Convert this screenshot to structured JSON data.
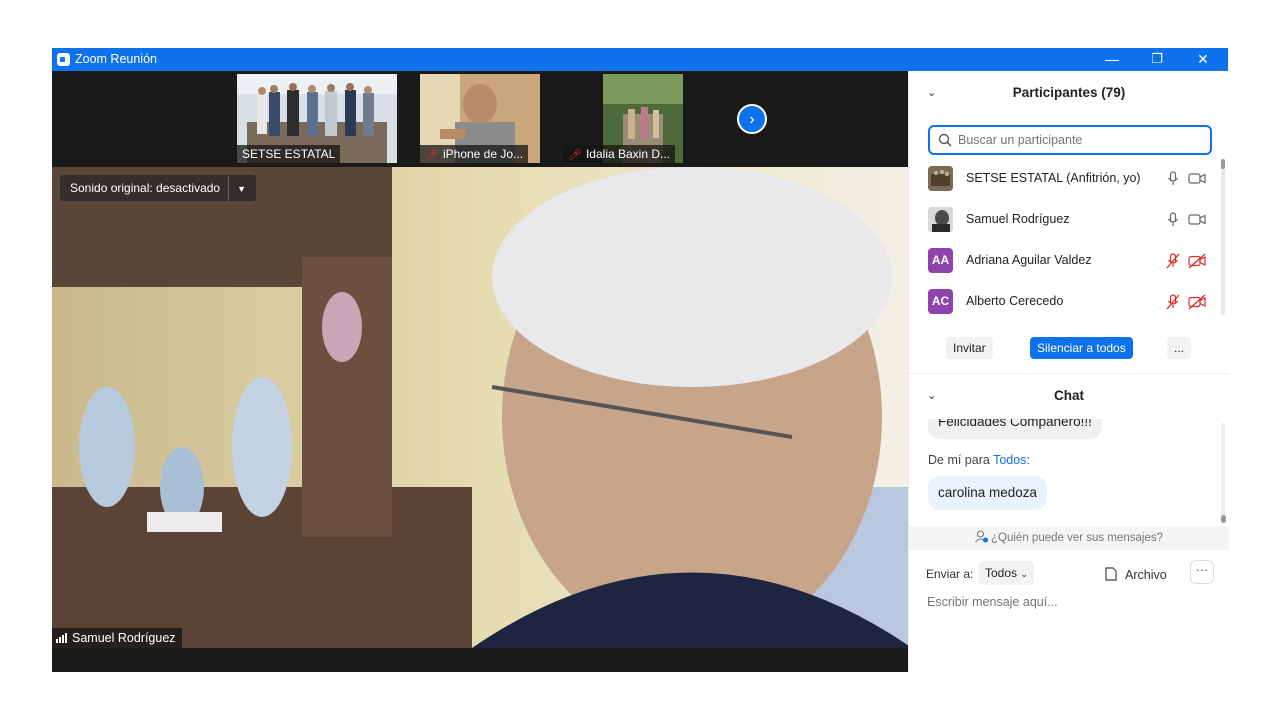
{
  "window": {
    "title": "Zoom Reunión",
    "minimize": "—",
    "restore": "❐",
    "close": "✕"
  },
  "thumbnails": [
    {
      "label": "SETSE ESTATAL",
      "muted": false
    },
    {
      "label": "iPhone de Jo...",
      "muted": true
    },
    {
      "label": "Idalia Baxin D...",
      "muted": true
    }
  ],
  "next_arrow": "›",
  "main_video": {
    "sound_label": "Sonido original: desactivado",
    "caret": "▼",
    "speaker_name": "Samuel Rodríguez"
  },
  "participants": {
    "title": "Participantes (79)",
    "search_placeholder": "Buscar un participante",
    "list": [
      {
        "name": "SETSE ESTATAL (Anfitrión, yo)",
        "initials": "",
        "color": "#6b5a45",
        "muted": false
      },
      {
        "name": "Samuel Rodríguez",
        "initials": "",
        "color": "#888888",
        "muted": false
      },
      {
        "name": "Adriana Aguilar Valdez",
        "initials": "AA",
        "color": "#8e44ad",
        "muted": true
      },
      {
        "name": "Alberto Cerecedo",
        "initials": "AC",
        "color": "#8e44ad",
        "muted": true
      }
    ],
    "invite": "Invitar",
    "mute_all": "Silenciar a todos",
    "more": "..."
  },
  "chat": {
    "title": "Chat",
    "previous_message": "Felicidades Compañero!!!",
    "from_prefix": "De mí para ",
    "from_to": "Todos",
    "from_suffix": ":",
    "message": "carolina medoza",
    "who_sees": "¿Quién puede ver sus mensajes?",
    "send_to_label": "Enviar a:",
    "send_to_value": "Todos",
    "file_label": "Archivo",
    "more": "···",
    "input_placeholder": "Escribir mensaje aquí..."
  },
  "colors": {
    "brand": "#0e72ed",
    "muted_red": "#e02828"
  }
}
